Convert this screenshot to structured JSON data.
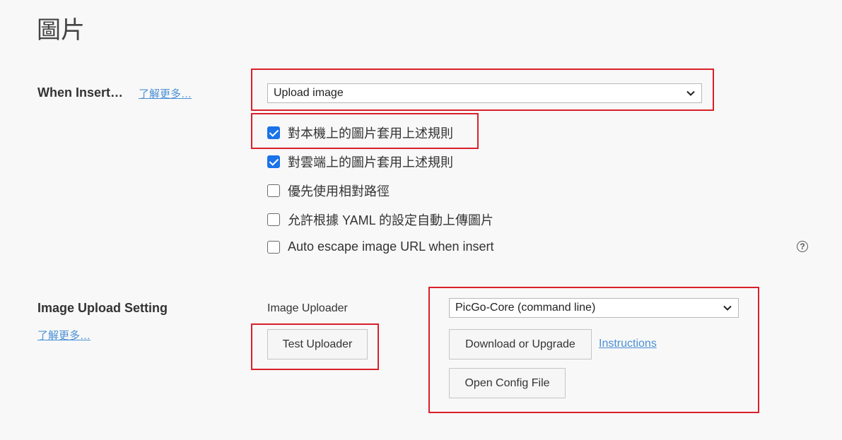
{
  "page": {
    "title": "圖片"
  },
  "when_insert": {
    "label": "When Insert…",
    "learn_more": "了解更多…",
    "select_value": "Upload image",
    "options": [
      {
        "label": "對本機上的圖片套用上述規則",
        "checked": true
      },
      {
        "label": "對雲端上的圖片套用上述規則",
        "checked": true
      },
      {
        "label": "優先使用相對路徑",
        "checked": false
      },
      {
        "label": "允許根據 YAML 的設定自動上傳圖片",
        "checked": false
      },
      {
        "label": "Auto escape image URL when insert",
        "checked": false
      }
    ],
    "help_icon": "?"
  },
  "upload": {
    "label": "Image Upload Setting",
    "learn_more": "了解更多…",
    "uploader_label": "Image Uploader",
    "test_button": "Test Uploader",
    "uploader_select_value": "PicGo-Core (command line)",
    "download_button": "Download or Upgrade",
    "instructions_link": "Instructions",
    "open_config_button": "Open Config File"
  },
  "colors": {
    "highlight": "#d9202a",
    "checkbox_checked": "#1a73e8",
    "link": "#4a8fd6"
  }
}
